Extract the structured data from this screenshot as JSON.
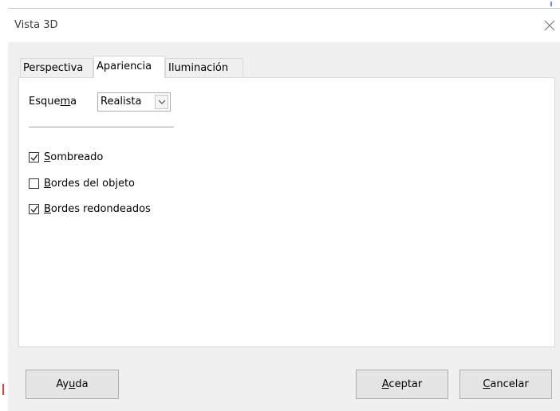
{
  "window": {
    "title": "Vista 3D"
  },
  "tabs": [
    {
      "label": "Perspectiva",
      "selected": false
    },
    {
      "label": "Apariencia",
      "selected": true
    },
    {
      "label": "Iluminación",
      "selected": false
    }
  ],
  "esquema": {
    "label_pre": "Esque",
    "label_mnemonic": "m",
    "label_post": "a",
    "value": "Realista"
  },
  "checkboxes": [
    {
      "mnemonic": "S",
      "rest": "ombreado",
      "checked": true
    },
    {
      "mnemonic": "B",
      "rest": "ordes del objeto",
      "checked": false
    },
    {
      "mnemonic": "B",
      "rest": "ordes redondeados",
      "checked": true
    }
  ],
  "buttons": {
    "help": {
      "pre": "Ay",
      "mnemonic": "u",
      "post": "da"
    },
    "ok": {
      "pre": "",
      "mnemonic": "A",
      "post": "ceptar"
    },
    "cancel": {
      "pre": "",
      "mnemonic": "C",
      "post": "ancelar"
    }
  },
  "icons": {
    "close": "close-icon",
    "dropdown": "chevron-down-icon",
    "check": "checkmark-icon"
  }
}
